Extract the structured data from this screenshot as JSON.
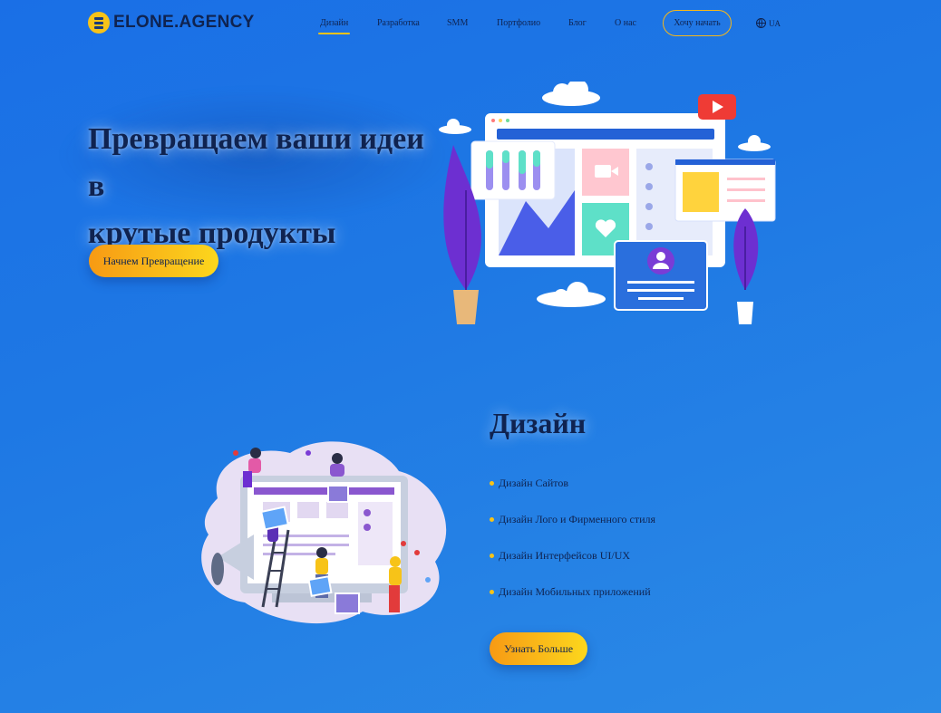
{
  "brand": {
    "name": "ELONE.AGENCY"
  },
  "nav": {
    "items": [
      "Дизайн",
      "Разработка",
      "SMM",
      "Портфолио",
      "Блог",
      "О нас"
    ],
    "active": "Дизайн",
    "cta": "Хочу начать",
    "lang": "UA"
  },
  "hero": {
    "title_line1": "Превращаем ваши идеи в",
    "title_line2": "крутые продукты",
    "button": "Начнем Превращение"
  },
  "design_section": {
    "title": "Дизайн",
    "items": [
      "Дизайн Сайтов",
      "Дизайн Лого и Фирменного стиля",
      "Дизайн Интерфейсов UI/UX",
      "Дизайн Мобильных приложений"
    ],
    "button": "Узнать Больше"
  },
  "colors": {
    "accent": "#f7c318",
    "text": "#0f2350",
    "bg": "#1e78e4",
    "purple": "#7a3cd6"
  },
  "icons": [
    "globe-icon",
    "play-icon",
    "user-icon",
    "heart-icon",
    "camera-icon",
    "megaphone-icon"
  ]
}
